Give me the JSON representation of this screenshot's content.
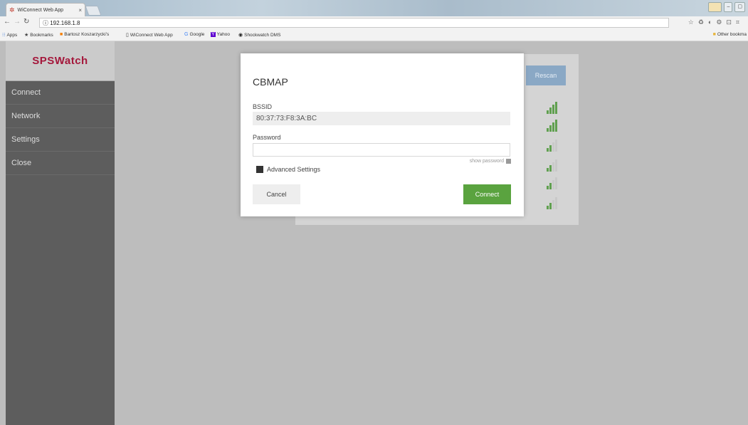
{
  "browser": {
    "tab_title": "WiConnect Web App",
    "tab_close": "×",
    "url": "192.168.1.8",
    "bookmarks": [
      {
        "label": "Apps",
        "icon": "apps-grid-icon"
      },
      {
        "label": "Bookmarks",
        "icon": "star-icon"
      },
      {
        "label": "Bartosz Koszarzycki's",
        "icon": "blogger-icon"
      },
      {
        "label": "WiConnect Web App",
        "icon": "page-icon"
      },
      {
        "label": "Google",
        "icon": "google-icon"
      },
      {
        "label": "Yahoo",
        "icon": "yahoo-icon"
      },
      {
        "label": "Shockwatch DMS",
        "icon": "shockwatch-icon"
      }
    ],
    "other_bookmarks": "Other bookma"
  },
  "app": {
    "logo": "SPSWatch",
    "nav": [
      "Connect",
      "Network",
      "Settings",
      "Close"
    ],
    "rescan_label": "Rescan",
    "signals": [
      {
        "strength": 4
      },
      {
        "strength": 4
      },
      {
        "strength": 2
      },
      {
        "strength": 2
      },
      {
        "strength": 2
      },
      {
        "strength": 2
      }
    ],
    "colors": {
      "accent_green": "#5aa33f",
      "sidebar": "#5d5d5d",
      "rescan": "#8aa8c5",
      "logo": "#a4173b"
    }
  },
  "modal": {
    "title": "CBMAP",
    "bssid_label": "BSSID",
    "bssid_value": "80:37:73:F8:3A:BC",
    "password_label": "Password",
    "password_value": "",
    "show_password_label": "show password",
    "advanced_label": "Advanced Settings",
    "cancel_label": "Cancel",
    "connect_label": "Connect"
  }
}
